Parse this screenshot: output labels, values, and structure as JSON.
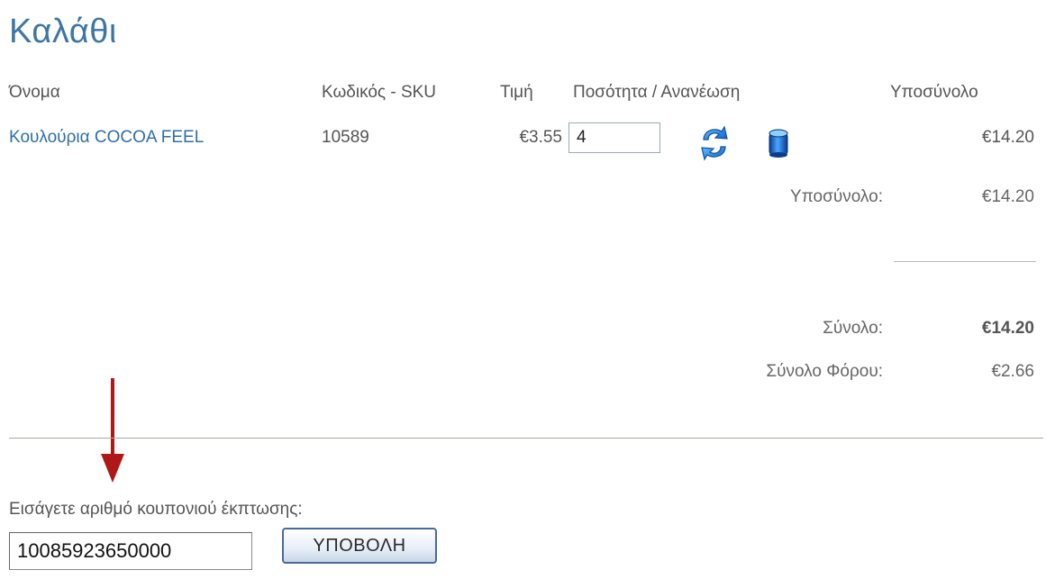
{
  "page": {
    "title": "Καλάθι"
  },
  "table": {
    "headers": {
      "name": "Όνομα",
      "sku": "Κωδικός - SKU",
      "price": "Τιμή",
      "quantity_update": "Ποσότητα / Ανανέωση",
      "subtotal": "Υποσύνολο"
    },
    "rows": [
      {
        "name": "Κουλούρια COCOA FEEL",
        "sku": "10589",
        "price": "€3.55",
        "quantity": "4",
        "subtotal": "€14.20",
        "update_icon": "refresh-arrows-icon",
        "delete_icon": "trash-can-icon"
      }
    ]
  },
  "summary": {
    "subtotal_label": "Υποσύνολο:",
    "subtotal_value": "€14.20",
    "total_label": "Σύνολο:",
    "total_value": "€14.20",
    "tax_label": "Σύνολο Φόρου:",
    "tax_value": "€2.66"
  },
  "coupon": {
    "label": "Εισάγετε αριθμό κουπονιού έκπτωσης:",
    "value": "10085923650000",
    "submit_label": "ΥΠΟΒΟΛΗ",
    "annotation_icon": "red-down-arrow-icon"
  },
  "colors": {
    "title": "#3d76a6",
    "link": "#2e6fa5",
    "arrow": "#b01818",
    "icon_blue": "#1a7fe0"
  }
}
